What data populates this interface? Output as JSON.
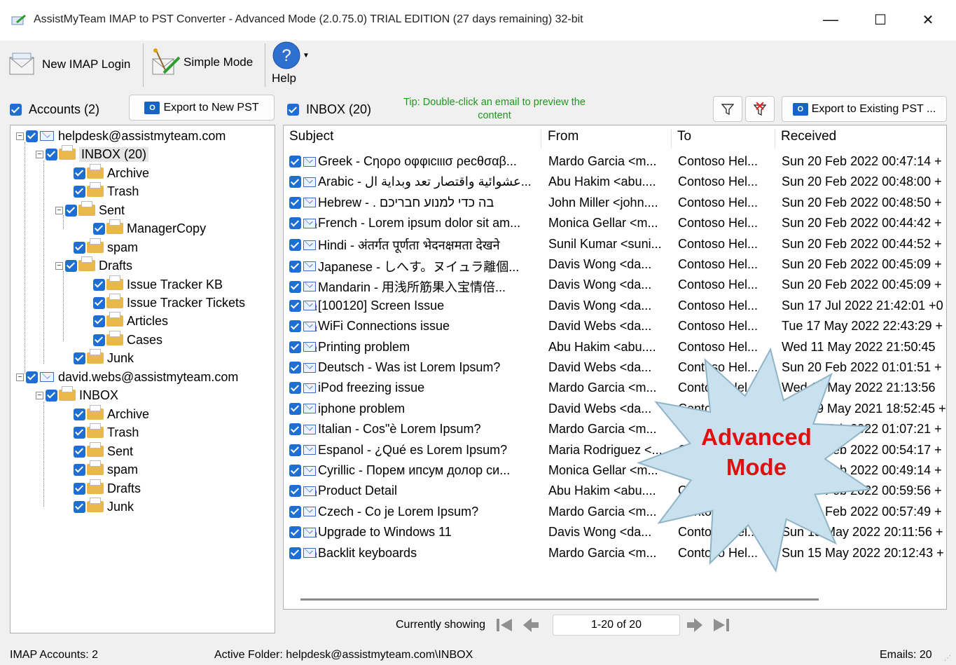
{
  "window": {
    "title": "AssistMyTeam IMAP to PST Converter - Advanced Mode (2.0.75.0) TRIAL EDITION (27 days remaining) 32-bit",
    "minimize": "—",
    "maximize": "☐",
    "close": "✕"
  },
  "toolbar": {
    "new_login": "New IMAP Login",
    "simple_mode": "Simple Mode",
    "help": "Help"
  },
  "accounts": {
    "label": "Accounts (2)",
    "export_new": "Export to New PST"
  },
  "inbox": {
    "label": "INBOX (20)",
    "tip": "Tip: Double-click an email to preview the content",
    "export_existing": "Export to Existing PST ..."
  },
  "tree": {
    "acc1": "helpdesk@assistmyteam.com",
    "inbox1": "INBOX (20)",
    "archive1": "Archive",
    "trash1": "Trash",
    "sent1": "Sent",
    "managercopy": "ManagerCopy",
    "spam1": "spam",
    "drafts1": "Drafts",
    "itkb": "Issue Tracker KB",
    "itt": "Issue Tracker Tickets",
    "articles": "Articles",
    "cases": "Cases",
    "junk1": "Junk",
    "acc2": "david.webs@assistmyteam.com",
    "inbox2": "INBOX",
    "archive2": "Archive",
    "trash2": "Trash",
    "sent2": "Sent",
    "spam2": "spam",
    "drafts2": "Drafts",
    "junk2": "Junk"
  },
  "columns": {
    "subject": "Subject",
    "from": "From",
    "to": "To",
    "received": "Received"
  },
  "emails": [
    {
      "subject": "Greek - Cηορo οφφιcιιισ ρecθσαβ...",
      "from": "Mardo Garcia <m...",
      "to": "Contoso Hel...",
      "received": "Sun 20 Feb 2022 00:47:14 +",
      "attach": false
    },
    {
      "subject": "Arabic - عشوائية واقتصار تعد وبداية ال...",
      "from": "Abu Hakim <abu....",
      "to": "Contoso Hel...",
      "received": "Sun 20 Feb 2022 00:48:00 +",
      "attach": false
    },
    {
      "subject": "Hebrew - . בה כדי למנוע חבריכם",
      "from": "John Miller <john....",
      "to": "Contoso Hel...",
      "received": "Sun 20 Feb 2022 00:48:50 +",
      "attach": false
    },
    {
      "subject": "French - Lorem ipsum dolor sit am...",
      "from": "Monica Gellar <m...",
      "to": "Contoso Hel...",
      "received": "Sun 20 Feb 2022 00:44:42 +",
      "attach": true
    },
    {
      "subject": "Hindi - अंतर्गत पूर्णता भेदनक्षमता देखने",
      "from": "Sunil Kumar <suni...",
      "to": "Contoso Hel...",
      "received": "Sun 20 Feb 2022 00:44:52 +",
      "attach": false
    },
    {
      "subject": "Japanese - しへす。ヌイュラ離個...",
      "from": "Davis Wong <da...",
      "to": "Contoso Hel...",
      "received": "Sun 20 Feb 2022 00:45:09 +",
      "attach": false
    },
    {
      "subject": "Mandarin - 用浅所筋果入宝情倍...",
      "from": "Davis Wong <da...",
      "to": "Contoso Hel...",
      "received": "Sun 20 Feb 2022 00:45:09 +",
      "attach": false
    },
    {
      "subject": "[100120] Screen Issue",
      "from": "Davis Wong <da...",
      "to": "Contoso Hel...",
      "received": "Sun 17 Jul 2022 21:42:01 +0",
      "attach": true
    },
    {
      "subject": "WiFi Connections issue",
      "from": "David Webs <da...",
      "to": "Contoso Hel...",
      "received": "Tue 17 May 2022 22:43:29 +",
      "attach": true
    },
    {
      "subject": "Printing problem",
      "from": "Abu Hakim <abu....",
      "to": "Contoso Hel...",
      "received": "Wed 11 May 2022 21:50:45",
      "attach": true
    },
    {
      "subject": "Deutsch - Was ist Lorem Ipsum?",
      "from": "David Webs <da...",
      "to": "Contoso Hel...",
      "received": "Sun 20 Feb 2022 01:01:51 +",
      "attach": false
    },
    {
      "subject": "iPod freezing issue",
      "from": "Mardo Garcia <m...",
      "to": "Contoso Hel...",
      "received": "Wed 11 May 2022 21:13:56",
      "attach": false
    },
    {
      "subject": "iphone problem",
      "from": "David Webs <da...",
      "to": "Contoso Hel...",
      "received": "Mon 09 May 2021 18:52:45 +",
      "attach": false
    },
    {
      "subject": "Italian - Cos\"è Lorem Ipsum?",
      "from": "Mardo Garcia <m...",
      "to": "Contoso Hel...",
      "received": "Sun 20 Feb 2022 01:07:21 +",
      "attach": false
    },
    {
      "subject": " Espanol - ¿Qué es Lorem Ipsum?",
      "from": "Maria Rodriguez <...",
      "to": "Contoso Hel...",
      "received": "Sun 20 Feb 2022 00:54:17 +",
      "attach": false
    },
    {
      "subject": "Cyrillic - Порем ипсум долор си...",
      "from": "Monica Gellar <m...",
      "to": "Contoso Hel...",
      "received": "Sun 20 Feb 2022 00:49:14 +",
      "attach": false
    },
    {
      "subject": "Product Detail",
      "from": "Abu Hakim <abu....",
      "to": "Contoso Hel...",
      "received": "Sun 20 Feb 2022 00:59:56 +",
      "attach": true
    },
    {
      "subject": "Czech - Co je Lorem Ipsum?",
      "from": "Mardo Garcia <m...",
      "to": "Contoso Hel...",
      "received": "Sun 20 Feb 2022 00:57:49 +",
      "attach": false
    },
    {
      "subject": "Upgrade to Windows 11",
      "from": "Davis Wong <da...",
      "to": "Contoso Hel...",
      "received": "Sun 15 May 2022 20:11:56 +",
      "attach": true
    },
    {
      "subject": "Backlit keyboards",
      "from": "Mardo Garcia <m...",
      "to": "Contoso Hel...",
      "received": "Sun 15 May 2022 20:12:43 +",
      "attach": true
    }
  ],
  "pager": {
    "label": "Currently showing",
    "range": "1-20 of 20"
  },
  "badge": {
    "line1": "Advanced",
    "line2": "Mode",
    "color": "#e01010",
    "fill": "#c9e1ee"
  },
  "status": {
    "accounts": "IMAP Accounts: 2",
    "folder": "Active Folder: helpdesk@assistmyteam.com\\INBOX",
    "emails": "Emails: 20"
  },
  "colors": {
    "accent": "#1e6fd1",
    "tip": "#1a9a1a"
  }
}
